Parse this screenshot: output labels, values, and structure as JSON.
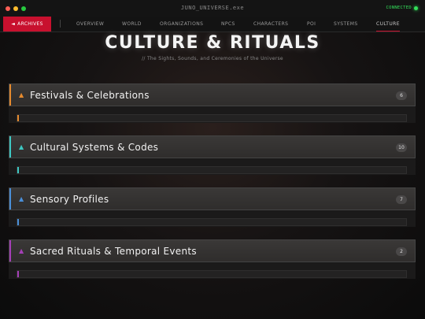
{
  "window": {
    "title": "JUNO_UNIVERSE.exe",
    "status_label": "CONNECTED",
    "status_color": "#33e05a"
  },
  "nav": {
    "back_label": "ARCHIVES",
    "back_icon": "left-triangle-icon",
    "accent_color": "#c8102e",
    "items": [
      {
        "label": "OVERVIEW"
      },
      {
        "label": "WORLD"
      },
      {
        "label": "ORGANIZATIONS"
      },
      {
        "label": "NPCS"
      },
      {
        "label": "CHARACTERS"
      },
      {
        "label": "POI"
      },
      {
        "label": "SYSTEMS"
      },
      {
        "label": "CULTURE",
        "active": true
      }
    ]
  },
  "page": {
    "title": "CULTURE & RITUALS",
    "subtitle": "// The Sights, Sounds, and Ceremonies of the Universe"
  },
  "sections": [
    {
      "title": "Festivals & Celebrations",
      "count": "6",
      "color": "#e58a2e",
      "icon": "triangle-up-icon"
    },
    {
      "title": "Cultural Systems & Codes",
      "count": "10",
      "color": "#3ec8c2",
      "icon": "triangle-up-icon"
    },
    {
      "title": "Sensory Profiles",
      "count": "7",
      "color": "#4a8fd8",
      "icon": "triangle-up-icon"
    },
    {
      "title": "Sacred Rituals & Temporal Events",
      "count": "2",
      "color": "#a43fb6",
      "icon": "triangle-up-icon"
    }
  ]
}
